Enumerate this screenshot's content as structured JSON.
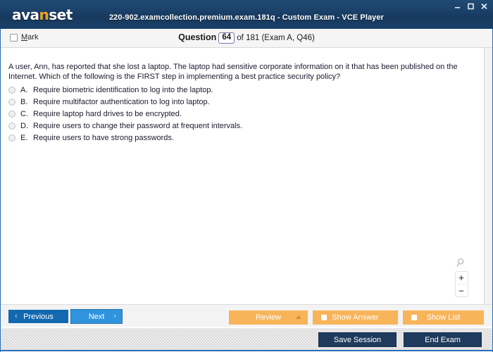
{
  "window": {
    "app_name": "avanset",
    "logo_prefix": "ava",
    "logo_accent": "n",
    "logo_suffix": "set",
    "title": "220-902.examcollection.premium.exam.181q - Custom Exam - VCE Player",
    "minimize_icon": "minimize-icon",
    "maximize_icon": "maximize-icon",
    "close_icon": "close-icon",
    "accent_color": "#1b4169",
    "border_color": "#2a6eb5"
  },
  "question_header": {
    "mark_label_accel": "M",
    "mark_label_rest": "ark",
    "mark_checked": false,
    "question_word": "Question",
    "question_number": "64",
    "of_text": "of 181 (Exam A, Q46)",
    "total_questions": 181,
    "exam_section": "Exam A",
    "exam_question_ref": "Q46",
    "number_box_border_color": "#7c6fb0"
  },
  "question": {
    "text": "A user, Ann, has reported that she lost a laptop. The laptop had sensitive corporate information on it that has been published on the Internet. Which of the following is the FIRST step in implementing a best practice security policy?",
    "options": [
      {
        "letter": "A.",
        "text": "Require biometric identification to log into the laptop.",
        "selected": false
      },
      {
        "letter": "B.",
        "text": "Require multifactor authentication to log into laptop.",
        "selected": false
      },
      {
        "letter": "C.",
        "text": "Require laptop hard drives to be encrypted.",
        "selected": false
      },
      {
        "letter": "D.",
        "text": "Require users to change their password at frequent intervals.",
        "selected": false
      },
      {
        "letter": "E.",
        "text": "Require users to have strong passwords.",
        "selected": false
      }
    ]
  },
  "zoom_widget": {
    "magnifier_icon": "magnifier-icon",
    "zoom_in_label": "+",
    "zoom_out_label": "–"
  },
  "toolbar": {
    "previous_label": "Previous",
    "previous_chevron": "‹",
    "next_label": "Next",
    "next_chevron": "›",
    "review_label": "Review",
    "show_answer_label": "Show Answer",
    "show_list_label": "Show List",
    "orange_color": "#f8b459",
    "primary_blue": "#1269b0",
    "focus_blue": "#2f93dd"
  },
  "statusbar": {
    "save_session_label": "Save Session",
    "end_exam_label": "End Exam",
    "dark_button_color": "#1e3a5c"
  }
}
